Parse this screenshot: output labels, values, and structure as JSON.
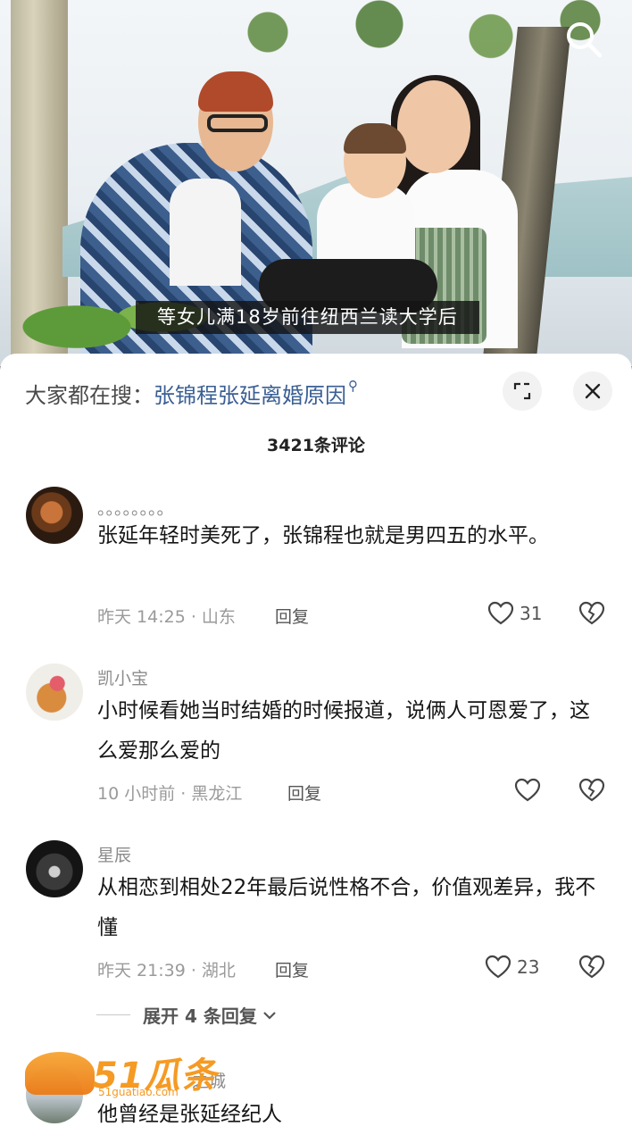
{
  "video": {
    "subtitle": "等女儿满18岁前往纽西兰读大学后"
  },
  "sheet": {
    "hot_search_prefix": "大家都在搜：",
    "hot_search_keyword": "张锦程张延离婚原因",
    "comment_count": "3421条评论"
  },
  "comments": [
    {
      "username": "。。。。。。。。",
      "text": "张延年轻时美死了，张锦程也就是男四五的水平。",
      "time": "昨天 14:25 · 山东",
      "reply_label": "回复",
      "likes": "31"
    },
    {
      "username": "凯小宝",
      "text": "小时候看她当时结婚的时候报道，说俩人可恩爱了，这么爱那么爱的",
      "time": "10 小时前 · 黑龙江",
      "reply_label": "回复",
      "likes": ""
    },
    {
      "username": "星辰",
      "text": "从相恋到相处22年最后说性格不合，价值观差异，我不懂",
      "time": "昨天 21:39 · 湖北",
      "reply_label": "回复",
      "likes": "23"
    },
    {
      "username": "之城",
      "text": "他曾经是张延经纪人",
      "time": "",
      "reply_label": "",
      "likes": ""
    }
  ],
  "expand_replies": "展开 4 条回复",
  "watermark": {
    "text": "51瓜条",
    "sub": "51guatiao.com"
  },
  "colors": {
    "keyword": "#3a5f93",
    "watermark": "#f59a23"
  }
}
